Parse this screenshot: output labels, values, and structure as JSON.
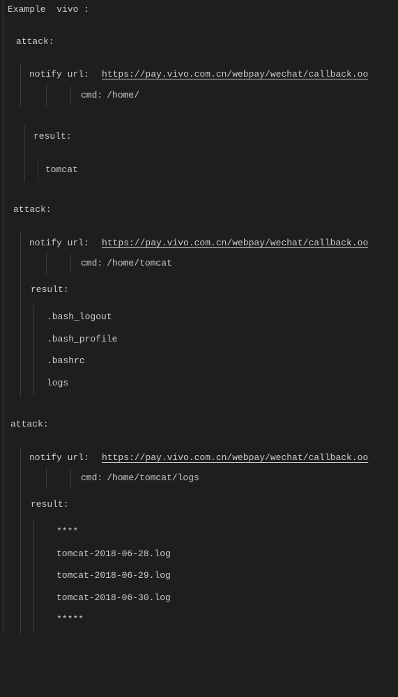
{
  "title": "Example  vivo :",
  "attacks": [
    {
      "label": "attack:",
      "notify_label": "notify url:",
      "notify_url": "https://pay.vivo.com.cn/webpay/wechat/callback.oo",
      "cmd_label": "cmd:",
      "cmd_value": "/home/",
      "result_label": "result:",
      "results": [
        "tomcat"
      ]
    },
    {
      "label": "attack:",
      "notify_label": "notify url:",
      "notify_url": "https://pay.vivo.com.cn/webpay/wechat/callback.oo",
      "cmd_label": "cmd:",
      "cmd_value": "/home/tomcat",
      "result_label": "result:",
      "results": [
        ".bash_logout",
        ".bash_profile",
        ".bashrc",
        "logs"
      ]
    },
    {
      "label": "attack:",
      "notify_label": "notify url:",
      "notify_url": "https://pay.vivo.com.cn/webpay/wechat/callback.oo",
      "cmd_label": "cmd:",
      "cmd_value": "/home/tomcat/logs",
      "result_label": "result:",
      "results": [
        "****",
        "tomcat-2018-06-28.log",
        "tomcat-2018-06-29.log",
        "tomcat-2018-06-30.log",
        "*****"
      ]
    }
  ]
}
